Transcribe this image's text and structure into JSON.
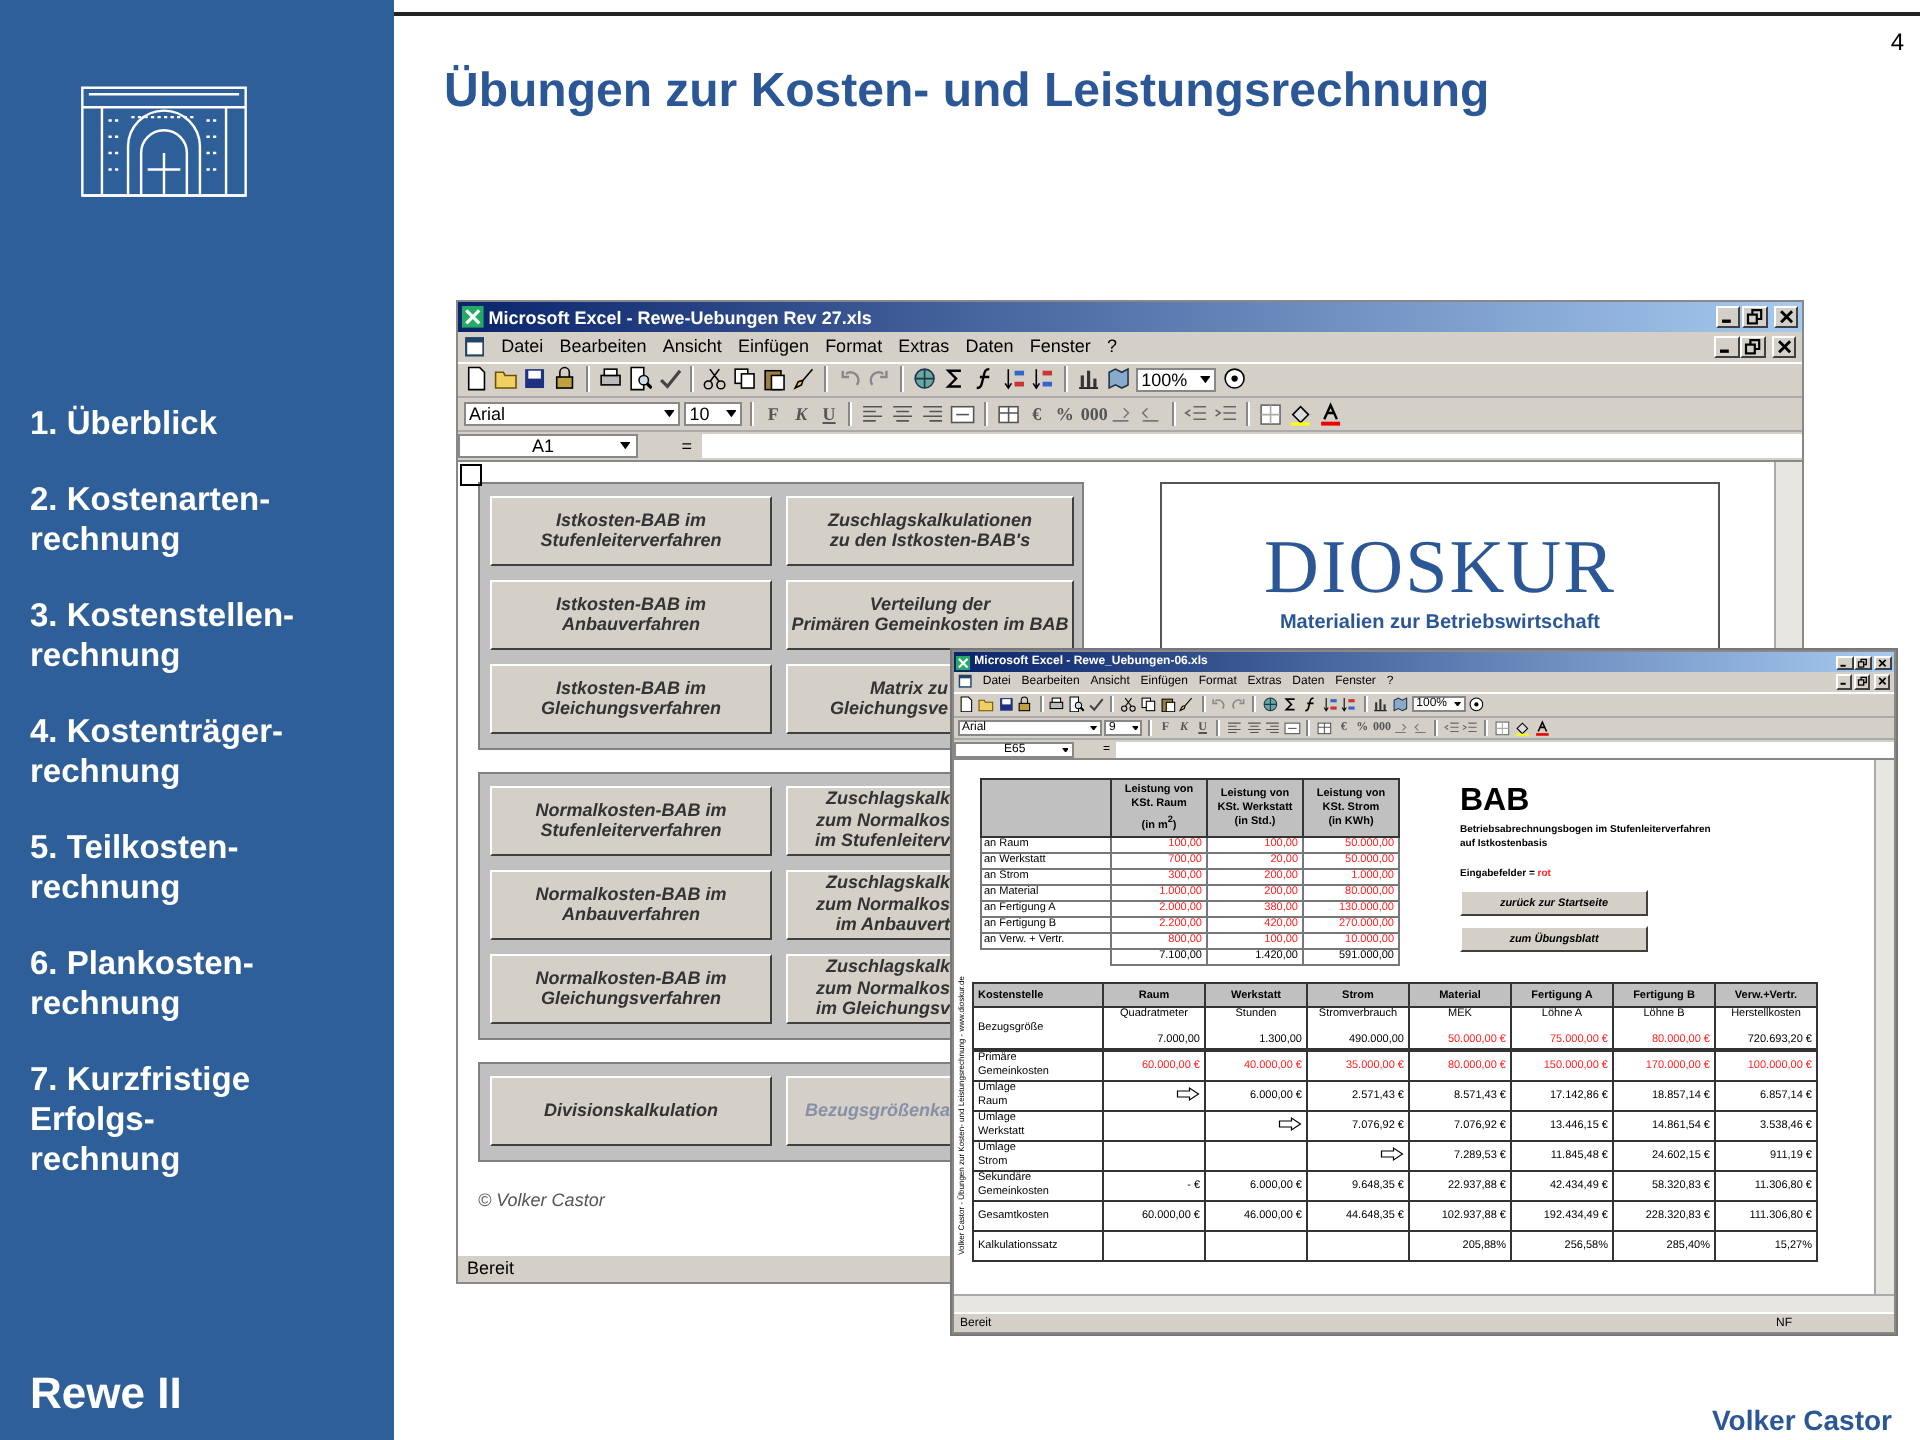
{
  "slide": {
    "page_number": "4",
    "title": "Übungen zur Kosten- und Leistungsrechnung",
    "author": "Volker Castor"
  },
  "sidebar": {
    "items": [
      {
        "lines": [
          "1. Überblick"
        ]
      },
      {
        "lines": [
          "2. Kostenarten-",
          "rechnung"
        ]
      },
      {
        "lines": [
          "3. Kostenstellen-",
          "rechnung"
        ]
      },
      {
        "lines": [
          "4. Kostenträger-",
          "rechnung"
        ]
      },
      {
        "lines": [
          "5. Teilkosten-",
          "rechnung"
        ]
      },
      {
        "lines": [
          "6. Plankosten-",
          "rechnung"
        ]
      },
      {
        "lines": [
          "7. Kurzfristige",
          "Erfolgs-",
          "rechnung"
        ]
      }
    ],
    "course": "Rewe II"
  },
  "excel_back": {
    "title": "Microsoft Excel - Rewe-Uebungen Rev 27.xls",
    "menu": [
      "Datei",
      "Bearbeiten",
      "Ansicht",
      "Einfügen",
      "Format",
      "Extras",
      "Daten",
      "Fenster",
      "?"
    ],
    "zoom": "100%",
    "font": "Arial",
    "font_size": "10",
    "format_buttons": [
      "F",
      "K",
      "U"
    ],
    "number_buttons": [
      "€",
      "%",
      "000"
    ],
    "cell_ref": "A1",
    "formula_sign": "=",
    "button_groups": [
      {
        "kind": "full",
        "buttons": [
          {
            "lines": [
              "Istkosten-BAB im",
              "Stufenleiterverfahren"
            ],
            "kind": "full",
            "disabled": false
          },
          {
            "lines": [
              "Zuschlagskalkulationen",
              "zu den Istkosten-BAB's"
            ],
            "kind": "full",
            "disabled": false
          },
          {
            "lines": [
              "Istkosten-BAB im",
              "Anbauverfahren"
            ],
            "kind": "full",
            "disabled": false
          },
          {
            "lines": [
              "Verteilung der",
              "Primären Gemeinkosten im BAB"
            ],
            "kind": "full",
            "disabled": false
          },
          {
            "lines": [
              "Istkosten-BAB im",
              "Gleichungsverfahren"
            ],
            "kind": "full",
            "disabled": false
          },
          {
            "lines": [
              "Matrix zu",
              "Gleichungsve"
            ],
            "kind": "cut",
            "disabled": false
          }
        ]
      },
      {
        "kind": "cut",
        "buttons": [
          {
            "lines": [
              "Normalkosten-BAB im",
              "Stufenleiterverfahren"
            ],
            "kind": "full",
            "disabled": false
          },
          {
            "lines": [
              "Zuschlagskalk",
              "zum Normalkos",
              "im Stufenleiterv"
            ],
            "kind": "cut",
            "disabled": false
          },
          {
            "lines": [
              "Normalkosten-BAB im",
              "Anbauverfahren"
            ],
            "kind": "full",
            "disabled": false
          },
          {
            "lines": [
              "Zuschlagskalk",
              "zum Normalkos",
              "im Anbauvert"
            ],
            "kind": "cut",
            "disabled": false
          },
          {
            "lines": [
              "Normalkosten-BAB im",
              "Gleichungsverfahren"
            ],
            "kind": "full",
            "disabled": false
          },
          {
            "lines": [
              "Zuschlagskalk",
              "zum Normalkos",
              "im Gleichungsv"
            ],
            "kind": "cut",
            "disabled": false
          }
        ]
      },
      {
        "kind": "cut",
        "buttons": [
          {
            "lines": [
              "Divisionskalkulation"
            ],
            "kind": "full",
            "disabled": false
          },
          {
            "lines": [
              "Bezugsgrößenka"
            ],
            "kind": "cut",
            "disabled": true
          }
        ]
      }
    ],
    "logo_title": "DIOSKUR",
    "logo_subtitle": "Materialien zur Betriebswirtschaft",
    "copyright": "© Volker Castor",
    "status": "Bereit"
  },
  "excel_front": {
    "title": "Microsoft Excel - Rewe_Uebungen-06.xls",
    "menu": [
      "Datei",
      "Bearbeiten",
      "Ansicht",
      "Einfügen",
      "Format",
      "Extras",
      "Daten",
      "Fenster",
      "?"
    ],
    "zoom": "100%",
    "font": "Arial",
    "font_size": "9",
    "format_buttons": [
      "F",
      "K",
      "U"
    ],
    "number_buttons": [
      "€",
      "%",
      "000"
    ],
    "cell_ref": "E65",
    "formula_sign": "=",
    "side_caption": "Volker Castor - Übungen zur Kosten- und Leistungsrechnung - www.dioskur.de",
    "service_table": {
      "columns": [
        [
          "Leistung von",
          "KSt. Raum",
          "(in m$^{2}$)"
        ],
        [
          "Leistung von",
          "KSt. Werkstatt",
          "(in Std.)"
        ],
        [
          "Leistung von",
          "KSt. Strom",
          "(in KWh)"
        ]
      ],
      "rows": [
        {
          "label": "an Raum",
          "values": [
            "100,00",
            "100,00",
            "50.000,00"
          ],
          "input": true
        },
        {
          "label": "an Werkstatt",
          "values": [
            "700,00",
            "20,00",
            "50.000,00"
          ],
          "input": true
        },
        {
          "label": "an Strom",
          "values": [
            "300,00",
            "200,00",
            "1.000,00"
          ],
          "input": true
        },
        {
          "label": "an Material",
          "values": [
            "1.000,00",
            "200,00",
            "80.000,00"
          ],
          "input": true
        },
        {
          "label": "an Fertigung A",
          "values": [
            "2.000,00",
            "380,00",
            "130.000,00"
          ],
          "input": true
        },
        {
          "label": "an Fertigung B",
          "values": [
            "2.200,00",
            "420,00",
            "270.000,00"
          ],
          "input": true
        },
        {
          "label": "an Verw. + Vertr.",
          "values": [
            "800,00",
            "100,00",
            "10.000,00"
          ],
          "input": true
        }
      ],
      "totals": [
        "7.100,00",
        "1.420,00",
        "591.000,00"
      ]
    },
    "bab_title": "BAB",
    "bab_subtitle": [
      "Betriebsabrechnungsbogen im Stufenleiterverfahren",
      "auf Istkostenbasis"
    ],
    "legend_label": "Eingabefelder = ",
    "legend_value": "rot",
    "buttons": [
      "zurück zur Startseite",
      "zum Übungsblatt"
    ],
    "bab_table": {
      "row_header": "Kostenstelle",
      "columns": [
        "Raum",
        "Werkstatt",
        "Strom",
        "Material",
        "Fertigung A",
        "Fertigung B",
        "Verw.+Vertr."
      ],
      "rows": [
        {
          "label": [
            "Bezugsgröße"
          ],
          "cells": [
            {
              "kind": "value",
              "unit": "Quadratmeter",
              "text": "7.000,00",
              "input": false
            },
            {
              "kind": "value",
              "unit": "Stunden",
              "text": "1.300,00",
              "input": false
            },
            {
              "kind": "value",
              "unit": "Stromverbrauch",
              "text": "490.000,00",
              "input": false
            },
            {
              "kind": "value",
              "unit": "MEK",
              "text": "50.000,00 €",
              "input": true
            },
            {
              "kind": "value",
              "unit": "Löhne A",
              "text": "75.000,00 €",
              "input": true
            },
            {
              "kind": "value",
              "unit": "Löhne B",
              "text": "80.000,00 €",
              "input": true
            },
            {
              "kind": "value",
              "unit": "Herstellkosten",
              "text": "720.693,20 €",
              "input": false
            }
          ]
        },
        {
          "label": [
            "Primäre",
            "Gemeinkosten"
          ],
          "cells": [
            {
              "kind": "value",
              "text": "60.000,00 €",
              "input": true
            },
            {
              "kind": "value",
              "text": "40.000,00 €",
              "input": true
            },
            {
              "kind": "value",
              "text": "35.000,00 €",
              "input": true
            },
            {
              "kind": "value",
              "text": "80.000,00 €",
              "input": true
            },
            {
              "kind": "value",
              "text": "150.000,00 €",
              "input": true
            },
            {
              "kind": "value",
              "text": "170.000,00 €",
              "input": true
            },
            {
              "kind": "value",
              "text": "100.000,00 €",
              "input": true
            }
          ]
        },
        {
          "label": [
            "Umlage",
            "Raum"
          ],
          "cells": [
            {
              "kind": "arrow"
            },
            {
              "kind": "value",
              "text": "6.000,00 €",
              "input": false
            },
            {
              "kind": "value",
              "text": "2.571,43 €",
              "input": false
            },
            {
              "kind": "value",
              "text": "8.571,43 €",
              "input": false
            },
            {
              "kind": "value",
              "text": "17.142,86 €",
              "input": false
            },
            {
              "kind": "value",
              "text": "18.857,14 €",
              "input": false
            },
            {
              "kind": "value",
              "text": "6.857,14 €",
              "input": false
            }
          ]
        },
        {
          "label": [
            "Umlage",
            "Werkstatt"
          ],
          "cells": [
            {
              "kind": "empty"
            },
            {
              "kind": "arrow"
            },
            {
              "kind": "value",
              "text": "7.076,92 €",
              "input": false
            },
            {
              "kind": "value",
              "text": "7.076,92 €",
              "input": false
            },
            {
              "kind": "value",
              "text": "13.446,15 €",
              "input": false
            },
            {
              "kind": "value",
              "text": "14.861,54 €",
              "input": false
            },
            {
              "kind": "value",
              "text": "3.538,46 €",
              "input": false
            }
          ]
        },
        {
          "label": [
            "Umlage",
            "Strom"
          ],
          "cells": [
            {
              "kind": "empty"
            },
            {
              "kind": "empty"
            },
            {
              "kind": "arrow"
            },
            {
              "kind": "value",
              "text": "7.289,53 €",
              "input": false
            },
            {
              "kind": "value",
              "text": "11.845,48 €",
              "input": false
            },
            {
              "kind": "value",
              "text": "24.602,15 €",
              "input": false
            },
            {
              "kind": "value",
              "text": "911,19 €",
              "input": false
            }
          ]
        },
        {
          "label": [
            "Sekundäre",
            "Gemeinkosten"
          ],
          "cells": [
            {
              "kind": "value",
              "text": "-   €",
              "input": false
            },
            {
              "kind": "value",
              "text": "6.000,00 €",
              "input": false
            },
            {
              "kind": "value",
              "text": "9.648,35 €",
              "input": false
            },
            {
              "kind": "value",
              "text": "22.937,88 €",
              "input": false
            },
            {
              "kind": "value",
              "text": "42.434,49 €",
              "input": false
            },
            {
              "kind": "value",
              "text": "58.320,83 €",
              "input": false
            },
            {
              "kind": "value",
              "text": "11.306,80 €",
              "input": false
            }
          ]
        },
        {
          "label": [
            "Gesamtkosten"
          ],
          "cells": [
            {
              "kind": "value",
              "text": "60.000,00 €",
              "input": false
            },
            {
              "kind": "value",
              "text": "46.000,00 €",
              "input": false
            },
            {
              "kind": "value",
              "text": "44.648,35 €",
              "input": false
            },
            {
              "kind": "value",
              "text": "102.937,88 €",
              "input": false
            },
            {
              "kind": "value",
              "text": "192.434,49 €",
              "input": false
            },
            {
              "kind": "value",
              "text": "228.320,83 €",
              "input": false
            },
            {
              "kind": "value",
              "text": "111.306,80 €",
              "input": false
            }
          ]
        },
        {
          "label": [
            "Kalkulationssatz"
          ],
          "cells": [
            {
              "kind": "empty"
            },
            {
              "kind": "empty"
            },
            {
              "kind": "empty"
            },
            {
              "kind": "value",
              "text": "205,88%",
              "input": false
            },
            {
              "kind": "value",
              "text": "256,58%",
              "input": false
            },
            {
              "kind": "value",
              "text": "285,40%",
              "input": false
            },
            {
              "kind": "value",
              "text": "15,27%",
              "input": false
            }
          ]
        }
      ]
    },
    "status": "Bereit",
    "status_indicator": "NF"
  }
}
